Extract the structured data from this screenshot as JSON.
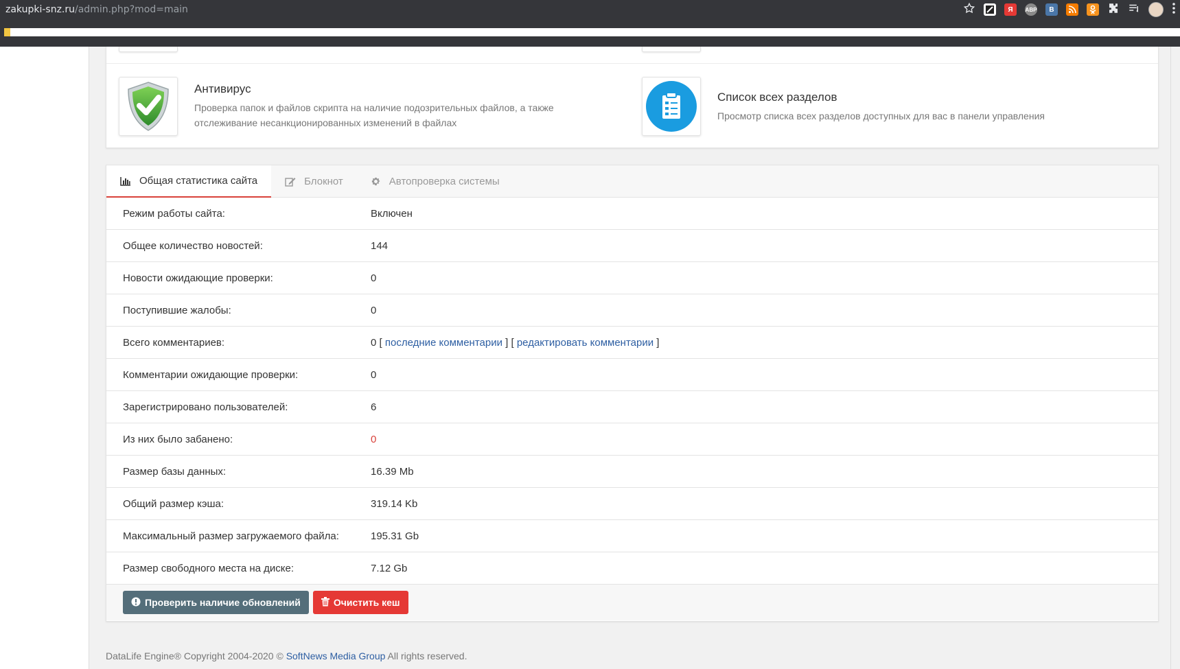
{
  "browser": {
    "url_host": "zakupki-snz.ru",
    "url_path": "/admin.php?mod=main",
    "extensions": [
      {
        "name": "bookmark-star-icon"
      },
      {
        "name": "extension-1-icon",
        "color": "#222222"
      },
      {
        "name": "yandex-icon",
        "label": "Я",
        "color": "#e53935"
      },
      {
        "name": "adblock-icon",
        "label": "ABP",
        "color": "#8a8a8a"
      },
      {
        "name": "vk-icon",
        "label": "B",
        "color": "#4a76a8"
      },
      {
        "name": "rss-icon",
        "color": "#f57c00"
      },
      {
        "name": "odnoklassniki-icon",
        "color": "#f7931e"
      },
      {
        "name": "puzzle-icon"
      },
      {
        "name": "reading-list-icon"
      },
      {
        "name": "profile-avatar"
      },
      {
        "name": "menu-dots-icon"
      }
    ]
  },
  "modules": [
    {
      "title": "Антивирус",
      "desc_line1": "Проверка папок и файлов скрипта на наличие подозрительных файлов, а также",
      "desc_line2": "отслеживание несанкционированных изменений в файлах",
      "icon": "shield-check-icon"
    },
    {
      "title": "Список всех разделов",
      "desc_line1": "Просмотр списка всех разделов доступных для вас в панели управления",
      "icon": "clipboard-list-icon"
    }
  ],
  "tabs": [
    {
      "label": "Общая статистика сайта",
      "icon": "bar-chart-icon",
      "active": true
    },
    {
      "label": "Блокнот",
      "icon": "edit-icon",
      "active": false
    },
    {
      "label": "Автопроверка системы",
      "icon": "gear-icon",
      "active": false
    }
  ],
  "stats": [
    {
      "label": "Режим работы сайта:",
      "value": "Включен"
    },
    {
      "label": "Общее количество новостей:",
      "value": "144"
    },
    {
      "label": "Новости ожидающие проверки:",
      "value": "0"
    },
    {
      "label": "Поступившие жалобы:",
      "value": "0"
    },
    {
      "label": "Всего комментариев:",
      "value": "0",
      "link1": "последние комментарии",
      "link2": "редактировать комментарии"
    },
    {
      "label": "Комментарии ожидающие проверки:",
      "value": "0"
    },
    {
      "label": "Зарегистрировано пользователей:",
      "value": "6"
    },
    {
      "label": "Из них было забанено:",
      "value": "0"
    },
    {
      "label": "Размер базы данных:",
      "value": "16.39 Mb"
    },
    {
      "label": "Общий размер кэша:",
      "value": "319.14 Kb"
    },
    {
      "label": "Максимальный размер загружаемого файла:",
      "value": "195.31 Gb"
    },
    {
      "label": "Размер свободного места на диске:",
      "value": "7.12 Gb"
    }
  ],
  "actions": {
    "check_updates": "Проверить наличие обновлений",
    "clear_cache": "Очистить кеш"
  },
  "footer": {
    "prefix": "DataLife Engine® Copyright 2004-2020 ©",
    "link": "SoftNews Media Group",
    "suffix": "All rights reserved."
  },
  "colors": {
    "accent_red": "#d9413a",
    "link_blue": "#2d5ea2",
    "button_dark": "#546e7a",
    "button_red": "#e53935"
  }
}
